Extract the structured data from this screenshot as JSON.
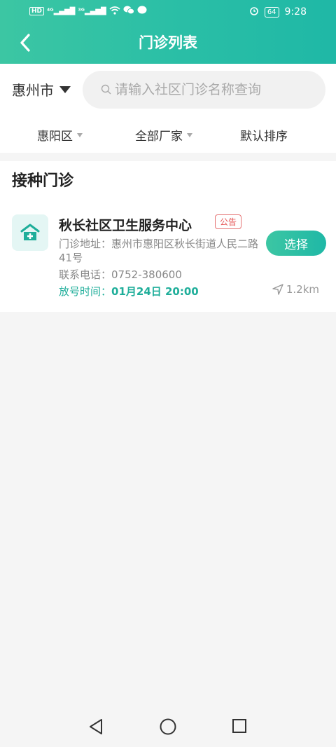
{
  "status_bar": {
    "left_icons": [
      "hd-icon",
      "signal-4g-icon",
      "signal-3g-icon",
      "wifi-icon",
      "wechat-icon",
      "message-icon"
    ],
    "battery": "64",
    "time": "9:28"
  },
  "header": {
    "title": "门诊列表"
  },
  "search": {
    "city": "惠州市",
    "placeholder": "请输入社区门诊名称查询"
  },
  "filters": {
    "district": "惠阳区",
    "manufacturer": "全部厂家",
    "sort": "默认排序"
  },
  "section": {
    "title": "接种门诊"
  },
  "clinics": [
    {
      "name": "秋长社区卫生服务中心",
      "badge": "公告",
      "address_label": "门诊地址：",
      "address": "惠州市惠阳区秋长街道人民二路41号",
      "phone_label": "联系电话：",
      "phone": "0752-380600",
      "time_label": "放号时间：",
      "time": "01月24日 20:00",
      "button": "选择",
      "distance": "1.2km"
    }
  ],
  "colors": {
    "accent": "#2bbfa6",
    "badge": "#e55757",
    "time_text": "#1fae9a"
  }
}
